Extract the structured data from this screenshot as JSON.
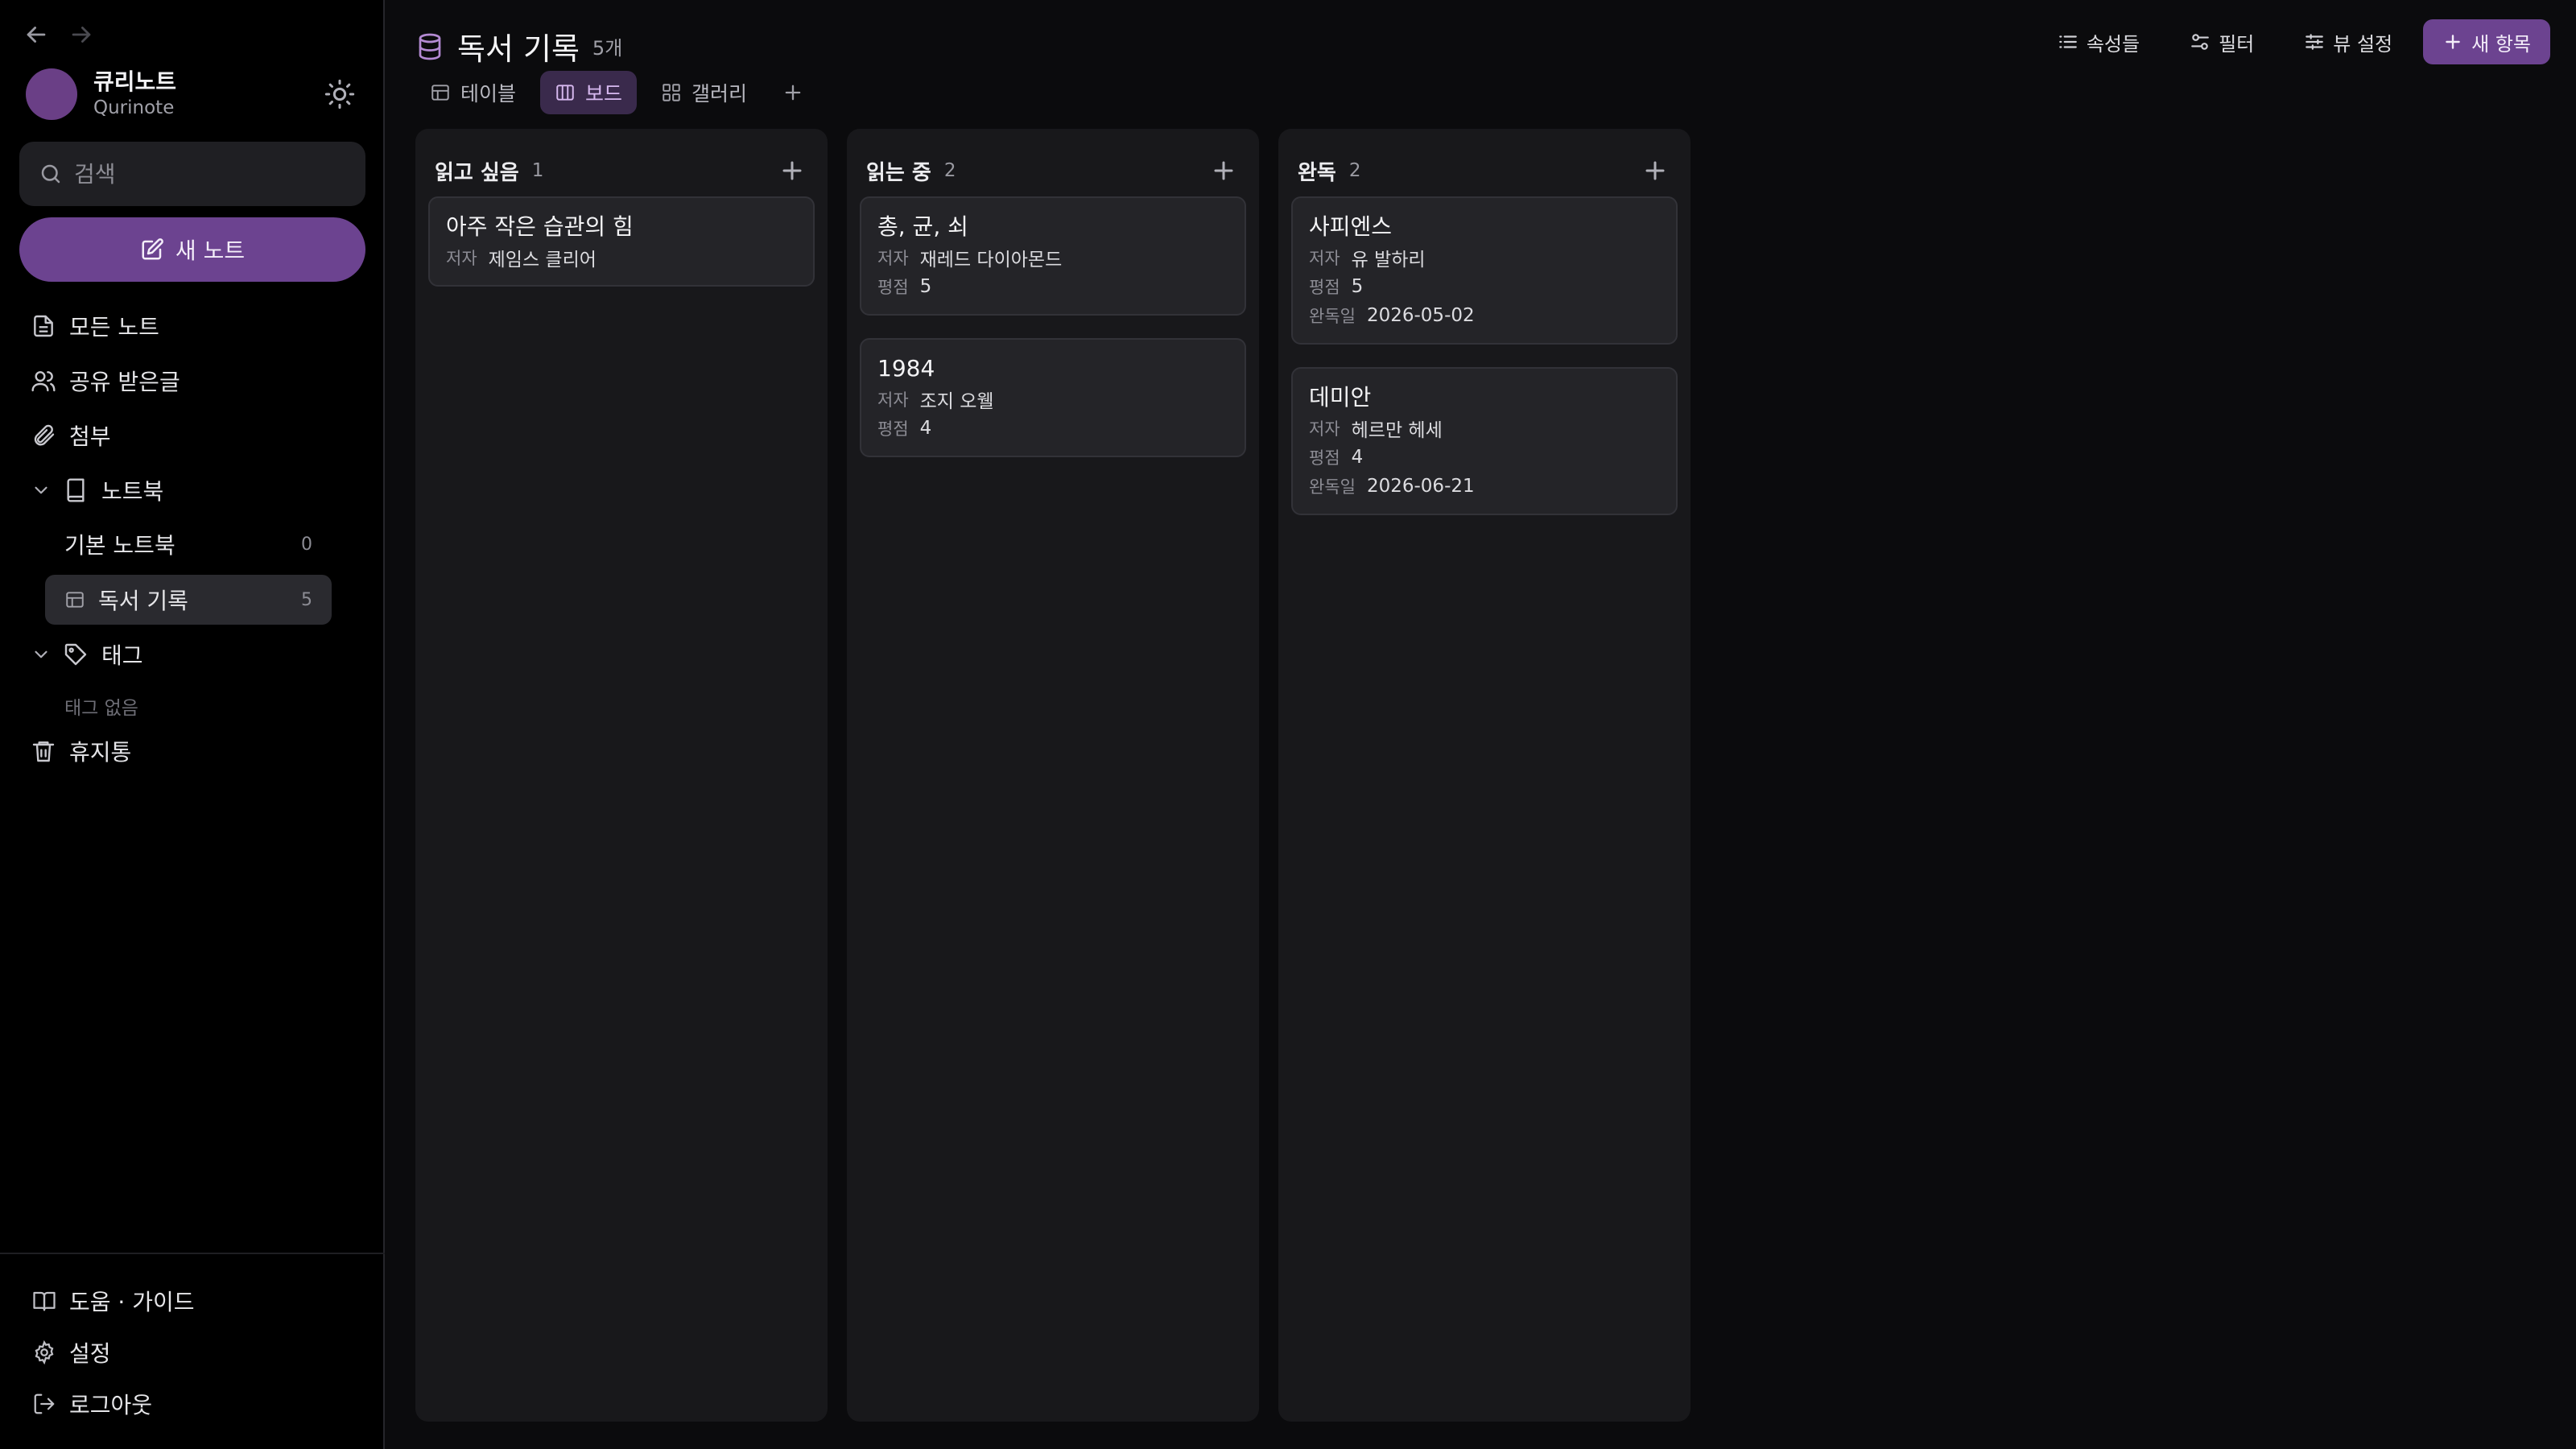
{
  "sidebar": {
    "profile": {
      "avatar_glyph": "",
      "name": "큐리노트",
      "app": "Qurinote"
    },
    "search_placeholder": "검색",
    "new_note_label": "새 노트",
    "nav": [
      {
        "label": "모든 노트",
        "icon": "document-icon"
      },
      {
        "label": "공유 받은글",
        "icon": "users-icon"
      },
      {
        "label": "첨부",
        "icon": "paperclip-icon"
      }
    ],
    "notebook_section": {
      "label": "노트북",
      "items": [
        {
          "label": "기본 노트북",
          "count": "0"
        },
        {
          "label": "독서 기록",
          "count": "5"
        }
      ]
    },
    "tag_section": {
      "label": "태그",
      "empty_text": "태그 없음"
    },
    "trash_label": "휴지통",
    "bottom": [
      {
        "label": "도움 · 가이드",
        "icon": "book-open-icon"
      },
      {
        "label": "설정",
        "icon": "gear-icon"
      },
      {
        "label": "로그아웃",
        "icon": "logout-icon"
      }
    ]
  },
  "header": {
    "title": "독서 기록",
    "count": "5개",
    "toolbar": {
      "properties_label": "속성들",
      "filter_label": "필터",
      "sort_label": "뷰 설정",
      "new_label": "새 항목"
    },
    "views": [
      {
        "label": "테이블",
        "icon": "table-icon",
        "active": false
      },
      {
        "label": "보드",
        "icon": "board-icon",
        "active": true
      },
      {
        "label": "갤러리",
        "icon": "gallery-icon",
        "active": false
      }
    ]
  },
  "board": {
    "columns": [
      {
        "title": "읽고 싶음",
        "count": "1",
        "cards": [
          {
            "title": "아주 작은 습관의 힘",
            "rows": [
              {
                "name": "저자",
                "value": "제임스 클리어"
              }
            ]
          }
        ]
      },
      {
        "title": "읽는 중",
        "count": "2",
        "cards": [
          {
            "title": "총, 균, 쇠",
            "rows": [
              {
                "name": "저자",
                "value": "재레드 다이아몬드"
              },
              {
                "name": "평점",
                "value": "5"
              }
            ]
          },
          {
            "title": "1984",
            "rows": [
              {
                "name": "저자",
                "value": "조지 오웰"
              },
              {
                "name": "평점",
                "value": "4"
              }
            ]
          }
        ]
      },
      {
        "title": "완독",
        "count": "2",
        "cards": [
          {
            "title": "사피엔스",
            "rows": [
              {
                "name": "저자",
                "value": "유 발하리"
              },
              {
                "name": "평점",
                "value": "5"
              },
              {
                "name": "완독일",
                "value": "2026-05-02"
              }
            ]
          },
          {
            "title": "데미안",
            "rows": [
              {
                "name": "저자",
                "value": "헤르만 헤세"
              },
              {
                "name": "평점",
                "value": "4"
              },
              {
                "name": "완독일",
                "value": "2026-06-21"
              }
            ]
          }
        ]
      }
    ]
  }
}
